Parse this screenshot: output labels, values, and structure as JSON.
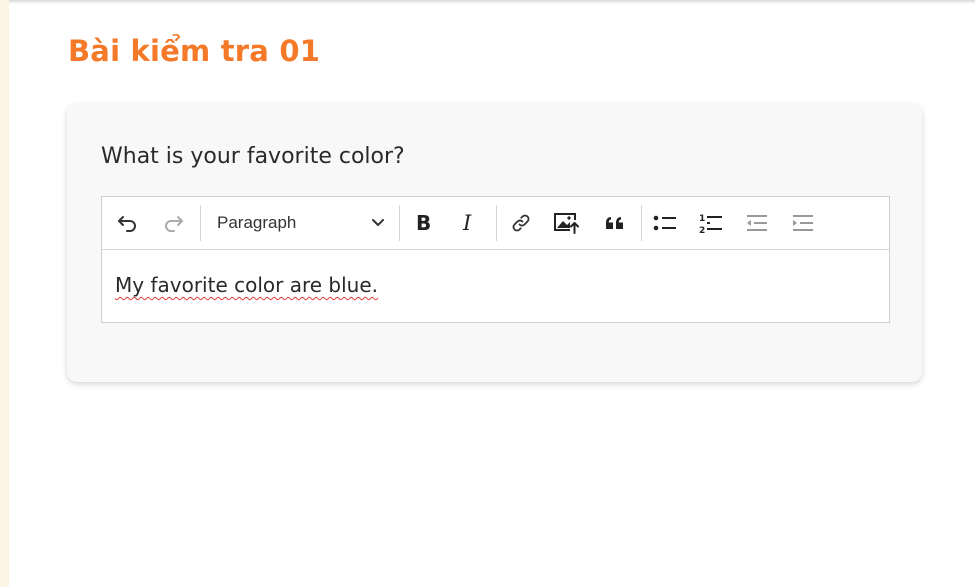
{
  "page": {
    "title": "Bài kiểm tra 01"
  },
  "question": {
    "text": "What is your favorite color?"
  },
  "editor": {
    "heading_select": "Paragraph",
    "content": "My favorite color are blue.",
    "toolbar_icons": [
      "undo-icon",
      "redo-icon",
      "bold-icon",
      "italic-icon",
      "link-icon",
      "insert-image-icon",
      "blockquote-icon",
      "bulleted-list-icon",
      "numbered-list-icon",
      "outdent-icon",
      "indent-icon"
    ]
  },
  "colors": {
    "title": "#f47a2a",
    "card_background": "#f8f8f8",
    "spellcheck_underline": "#e23b3b",
    "left_strip": "#fdf3e7"
  }
}
